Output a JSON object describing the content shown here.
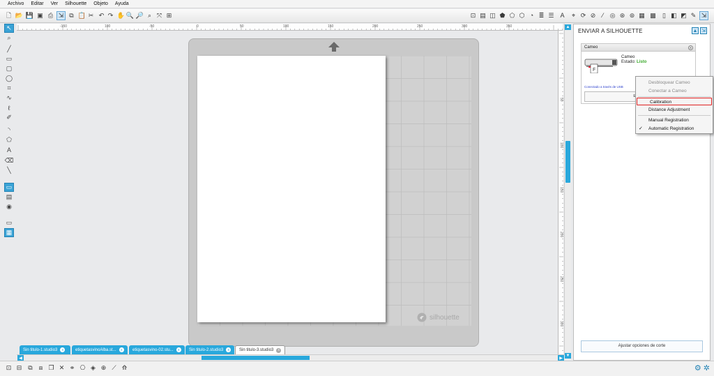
{
  "menu": [
    "Archivo",
    "Editar",
    "Ver",
    "Silhouette",
    "Objeto",
    "Ayuda"
  ],
  "icons": {
    "left_toolbar": [
      "select-icon",
      "node-edit-icon",
      "line-icon",
      "rectangle-icon",
      "rounded-rect-icon",
      "ellipse-icon",
      "polygon-icon",
      "curve-icon",
      "freehand-icon",
      "pencil-icon",
      "arc-icon",
      "regular-polygon-icon",
      "text-icon",
      "eraser-icon",
      "knife-icon",
      "design-view-icon",
      "store-icon",
      "library-icon",
      "design-page-icon",
      "send-page-icon"
    ]
  },
  "rulers": {
    "top": [
      "-150",
      "100",
      "-50",
      "0",
      "50",
      "100",
      "150",
      "200",
      "250",
      "300",
      "350"
    ],
    "left": [
      "50",
      "100",
      "150",
      "200",
      "250",
      "300"
    ]
  },
  "canvas": {
    "logo_text": "silhouette"
  },
  "tabs": [
    {
      "label": "Sin titulo-1.studio3",
      "active": false
    },
    {
      "label": "etiquetasvinoAlba.st...",
      "active": false
    },
    {
      "label": "etiquetasvino-02.stu...",
      "active": false
    },
    {
      "label": "Sin titulo-2.studio3",
      "active": false
    },
    {
      "label": "Sin titulo-3.studio3",
      "active": true
    }
  ],
  "panel": {
    "title": "ENVIAR A SILHOUETTE",
    "device": {
      "header": "Cameo",
      "name": "Cameo",
      "status_label": "Estado:",
      "status_value": "Listo",
      "connection": "Conectado a través de USB",
      "send_label": "Enviar"
    },
    "adjust_button": "Ajustar opciones de corte"
  },
  "context_menu": [
    {
      "label": "Desbloquear Cameo",
      "disabled": true
    },
    {
      "label": "Conectar a Cameo",
      "disabled": true
    },
    {
      "label": "Calibration",
      "highlighted": true
    },
    {
      "label": "Distance Adjustment"
    },
    {
      "label": "Manual Registration"
    },
    {
      "label": "Automatic Registration",
      "checked": true
    }
  ],
  "colors": {
    "accent": "#29a8dc",
    "status_ready": "#3aa82a",
    "highlight_outline": "#e02020"
  }
}
